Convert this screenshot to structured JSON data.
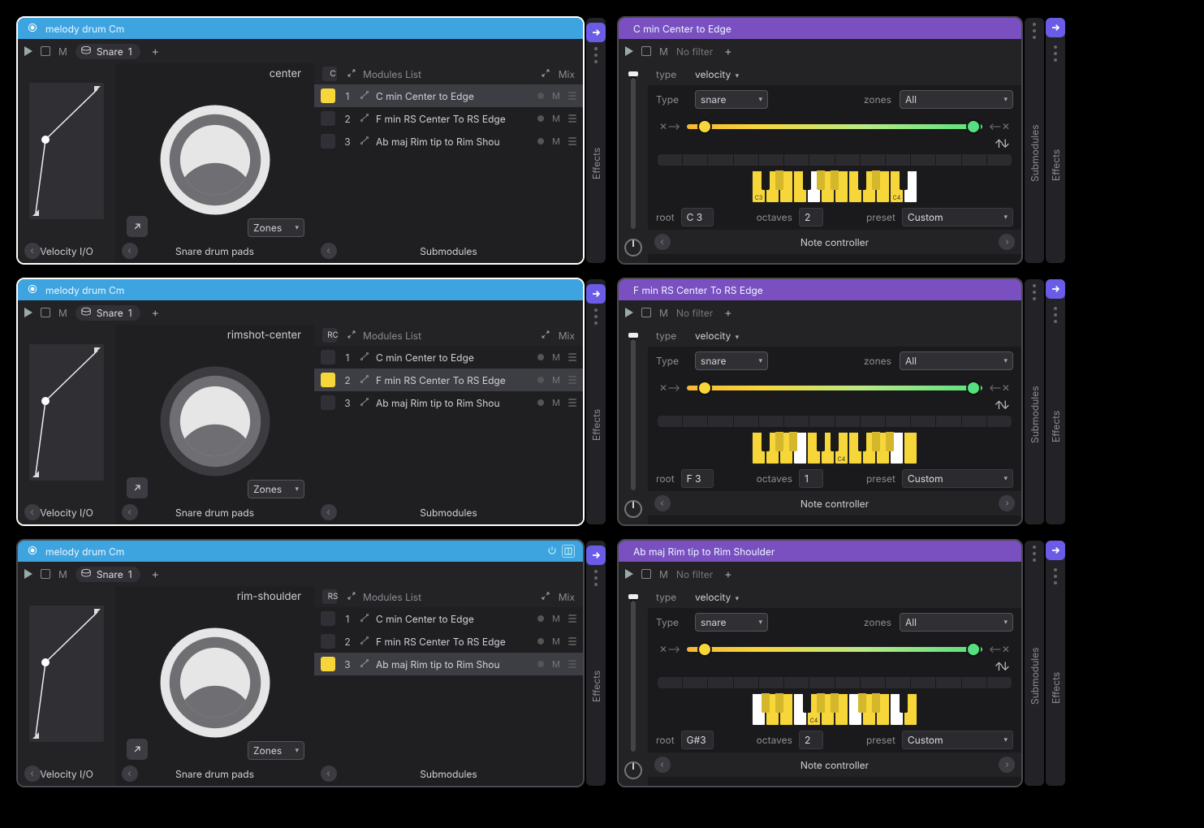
{
  "left": [
    {
      "title": "melody drum Cm",
      "pad_label": "center",
      "zone_tag": "C",
      "zone_select": "Zones",
      "vel_footer": "Velocity I/O",
      "pad_footer": "Snare drum pads",
      "sub_footer": "Submodules",
      "chip_label": "Snare",
      "chip_count": "1",
      "m_label": "M",
      "add": "+",
      "list_hdr": "Modules List",
      "mix_label": "Mix",
      "selected_row": 0,
      "ring_light": true,
      "rows": [
        {
          "idx": "1",
          "name": "C min Center to Edge",
          "mute": "M"
        },
        {
          "idx": "2",
          "name": "F min RS Center To RS Edge",
          "mute": "M"
        },
        {
          "idx": "3",
          "name": "Ab maj Rim tip to Rim Shou",
          "mute": "M"
        }
      ],
      "side_label": "Effects"
    },
    {
      "title": "melody drum Cm",
      "pad_label": "rimshot-center",
      "zone_tag": "RC",
      "zone_select": "Zones",
      "vel_footer": "Velocity I/O",
      "pad_footer": "Snare drum pads",
      "sub_footer": "Submodules",
      "chip_label": "Snare",
      "chip_count": "1",
      "m_label": "M",
      "add": "+",
      "list_hdr": "Modules List",
      "mix_label": "Mix",
      "selected_row": 1,
      "ring_light": false,
      "rows": [
        {
          "idx": "1",
          "name": "C min Center to Edge",
          "mute": "M"
        },
        {
          "idx": "2",
          "name": "F min RS Center To RS Edge",
          "mute": "M"
        },
        {
          "idx": "3",
          "name": "Ab maj Rim tip to Rim Shou",
          "mute": "M"
        }
      ],
      "side_label": "Effects"
    },
    {
      "title": "melody drum Cm",
      "pad_label": "rim-shoulder",
      "zone_tag": "RS",
      "zone_select": "Zones",
      "vel_footer": "Velocity I/O",
      "pad_footer": "Snare drum pads",
      "sub_footer": "Submodules",
      "chip_label": "Snare",
      "chip_count": "1",
      "m_label": "M",
      "add": "+",
      "list_hdr": "Modules List",
      "mix_label": "Mix",
      "selected_row": 2,
      "ring_light": true,
      "show_header_icons": true,
      "bordered": false,
      "rows": [
        {
          "idx": "1",
          "name": "C min Center to Edge",
          "mute": "M"
        },
        {
          "idx": "2",
          "name": "F min RS Center To RS Edge",
          "mute": "M"
        },
        {
          "idx": "3",
          "name": "Ab maj Rim tip to Rim Shou",
          "mute": "M"
        }
      ],
      "side_label": "Effects"
    }
  ],
  "right": [
    {
      "title": "C min Center to Edge",
      "m_label": "M",
      "filter_label": "No filter",
      "add": "+",
      "type_label": "type",
      "type_value": "velocity",
      "type2_label": "Type",
      "type2_value": "snare",
      "zones_label": "zones",
      "zones_value": "All",
      "root_label": "root",
      "root_value": "C 3",
      "oct_label": "octaves",
      "oct_value": "2",
      "preset_label": "preset",
      "preset_value": "Custom",
      "footer": "Note controller",
      "side1": "Submodules",
      "side2": "Effects",
      "piano": {
        "whites": [
          "yl",
          "yl",
          "yl",
          "yl",
          "wh",
          "yl",
          "yl",
          "yl",
          "yl",
          "yl",
          "yl",
          "wh"
        ],
        "labels": {
          "0": "C3",
          "10": "C4"
        },
        "blacks": [
          {
            "pos": 0,
            "c": "bk"
          },
          {
            "pos": 1,
            "c": "yl"
          },
          {
            "pos": 3,
            "c": "bk"
          },
          {
            "pos": 4,
            "c": "yl"
          },
          {
            "pos": 5,
            "c": "yl"
          },
          {
            "pos": 7,
            "c": "bk"
          },
          {
            "pos": 8,
            "c": "yl"
          },
          {
            "pos": 10,
            "c": "bk"
          }
        ]
      }
    },
    {
      "title": "F min RS Center To RS Edge",
      "m_label": "M",
      "filter_label": "No filter",
      "add": "+",
      "type_label": "type",
      "type_value": "velocity",
      "type2_label": "Type",
      "type2_value": "snare",
      "zones_label": "zones",
      "zones_value": "All",
      "root_label": "root",
      "root_value": "F 3",
      "oct_label": "octaves",
      "oct_value": "1",
      "preset_label": "preset",
      "preset_value": "Custom",
      "footer": "Note controller",
      "side1": "Submodules",
      "side2": "Effects",
      "piano": {
        "whites": [
          "yl",
          "yl",
          "yl",
          "wh",
          "yl",
          "yl",
          "yl",
          "yl",
          "yl",
          "yl",
          "wh",
          "yl"
        ],
        "labels": {
          "6": "C4"
        },
        "blacks": [
          {
            "pos": 0,
            "c": "bk"
          },
          {
            "pos": 1,
            "c": "yl"
          },
          {
            "pos": 2,
            "c": "yl"
          },
          {
            "pos": 4,
            "c": "bk"
          },
          {
            "pos": 5,
            "c": "bk"
          },
          {
            "pos": 7,
            "c": "bk"
          },
          {
            "pos": 8,
            "c": "yl"
          },
          {
            "pos": 9,
            "c": "yl"
          }
        ]
      }
    },
    {
      "title": "Ab maj Rim tip to Rim Shoulder",
      "m_label": "M",
      "filter_label": "No filter",
      "add": "+",
      "type_label": "type",
      "type_value": "velocity",
      "type2_label": "Type",
      "type2_value": "snare",
      "zones_label": "zones",
      "zones_value": "All",
      "root_label": "root",
      "root_value": "G#3",
      "oct_label": "octaves",
      "oct_value": "2",
      "preset_label": "preset",
      "preset_value": "Custom",
      "footer": "Note controller",
      "side1": "Submodules",
      "side2": "Effects",
      "piano": {
        "whites": [
          "wh",
          "yl",
          "yl",
          "wh",
          "yl",
          "yl",
          "yl",
          "wh",
          "yl",
          "yl",
          "wh",
          "yl"
        ],
        "labels": {
          "4": "C4"
        },
        "blacks": [
          {
            "pos": 0,
            "c": "yl"
          },
          {
            "pos": 1,
            "c": "yl"
          },
          {
            "pos": 3,
            "c": "bk"
          },
          {
            "pos": 4,
            "c": "yl"
          },
          {
            "pos": 5,
            "c": "yl"
          },
          {
            "pos": 7,
            "c": "yl"
          },
          {
            "pos": 8,
            "c": "yl"
          },
          {
            "pos": 10,
            "c": "bk"
          }
        ]
      }
    }
  ]
}
